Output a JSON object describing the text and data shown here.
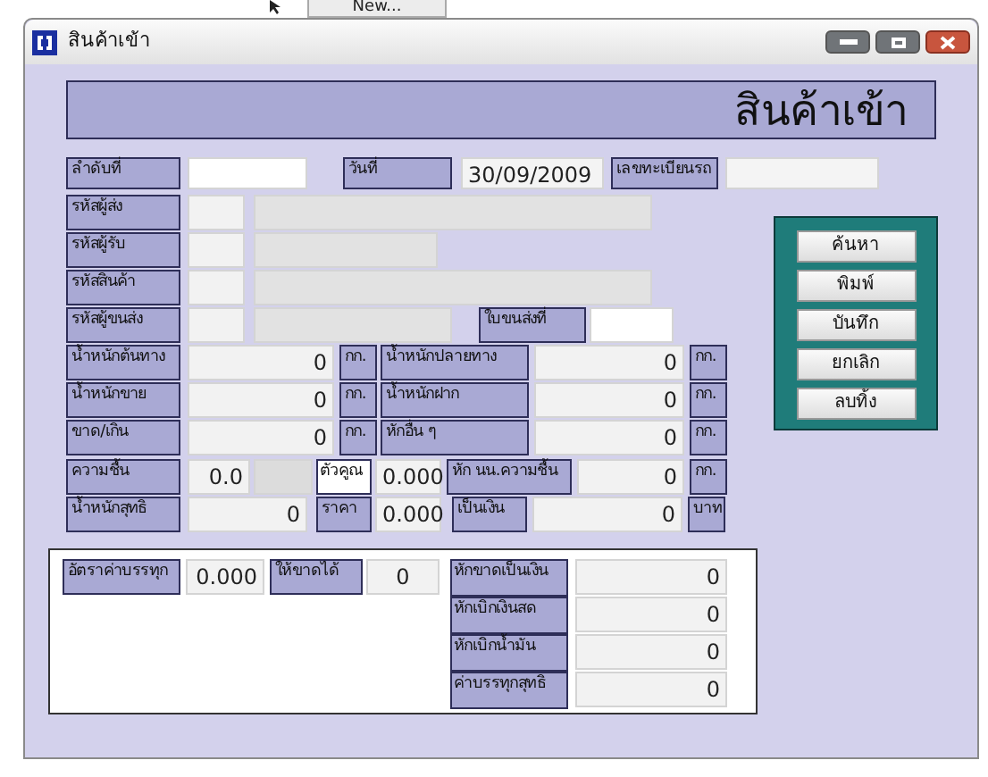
{
  "background": {
    "button": "New..."
  },
  "window": {
    "title": "สินค้าเข้า"
  },
  "header": "สินค้าเข้า",
  "rows": [
    [
      {
        "kind": "label",
        "text": "ลำดับที่"
      },
      {
        "kind": "input"
      },
      {
        "kind": "label",
        "text": "วันที่"
      },
      {
        "kind": "input",
        "value": "30/09/2009"
      },
      {
        "kind": "label",
        "text": "เลขทะเบียนรถ"
      },
      {
        "kind": "input"
      }
    ],
    [
      {
        "kind": "label",
        "text": "รหัสผู้ส่ง"
      },
      {
        "kind": "input"
      },
      {
        "kind": "input"
      }
    ],
    [
      {
        "kind": "label",
        "text": "รหัสผู้รับ"
      },
      {
        "kind": "input"
      },
      {
        "kind": "input"
      }
    ],
    [
      {
        "kind": "label",
        "text": "รหัสสินค้า"
      },
      {
        "kind": "input"
      },
      {
        "kind": "input"
      }
    ],
    [
      {
        "kind": "label",
        "text": "รหัสผู้ขนส่ง"
      },
      {
        "kind": "input"
      },
      {
        "kind": "input"
      },
      {
        "kind": "label",
        "text": "ใบขนส่งที่"
      },
      {
        "kind": "input"
      }
    ],
    [
      {
        "kind": "label",
        "text": "น้ำหนักต้นทาง"
      },
      {
        "kind": "input",
        "value": "0"
      },
      {
        "kind": "unit",
        "text": "กก."
      },
      {
        "kind": "label",
        "text": "น้ำหนักปลายทาง"
      },
      {
        "kind": "input",
        "value": "0"
      },
      {
        "kind": "unit",
        "text": "กก."
      }
    ],
    [
      {
        "kind": "label",
        "text": "น้ำหนักขาย"
      },
      {
        "kind": "input",
        "value": "0"
      },
      {
        "kind": "unit",
        "text": "กก."
      },
      {
        "kind": "label",
        "text": "น้ำหนักฝาก"
      },
      {
        "kind": "input",
        "value": "0"
      },
      {
        "kind": "unit",
        "text": "กก."
      }
    ],
    [
      {
        "kind": "label",
        "text": "ขาด/เกิน"
      },
      {
        "kind": "input",
        "value": "0"
      },
      {
        "kind": "unit",
        "text": "กก."
      },
      {
        "kind": "label",
        "text": "หักอื่น ๆ"
      },
      {
        "kind": "input",
        "value": "0"
      },
      {
        "kind": "unit",
        "text": "กก."
      }
    ],
    [
      {
        "kind": "label",
        "text": "ความชื้น"
      },
      {
        "kind": "input",
        "value": "0.0"
      },
      {
        "kind": "input"
      },
      {
        "kind": "tag",
        "text": "ตัวคูณ"
      },
      {
        "kind": "input",
        "value": "0.000"
      },
      {
        "kind": "label",
        "text": "หัก นน.ความชื้น"
      },
      {
        "kind": "input",
        "value": "0"
      },
      {
        "kind": "unit",
        "text": "กก."
      }
    ],
    [
      {
        "kind": "label",
        "text": "น้ำหนักสุทธิ"
      },
      {
        "kind": "input",
        "value": "0"
      },
      {
        "kind": "label",
        "text": "ราคา"
      },
      {
        "kind": "input",
        "value": "0.000"
      },
      {
        "kind": "label",
        "text": "เป็นเงิน"
      },
      {
        "kind": "input",
        "value": "0"
      },
      {
        "kind": "unit",
        "text": "บาท"
      }
    ]
  ],
  "actions": [
    "ค้นหา",
    "พิมพ์",
    "บันทึก",
    "ยกเลิก",
    "ลบทิ้ง"
  ],
  "freight": [
    {
      "kind": "label",
      "text": "อัตราค่าบรรทุก"
    },
    {
      "kind": "input",
      "value": "0.000"
    },
    {
      "kind": "label",
      "text": "ให้ขาดได้"
    },
    {
      "kind": "input",
      "value": "0"
    }
  ],
  "summary": [
    {
      "label": "หักขาดเป็นเงิน",
      "value": "0"
    },
    {
      "label": "หักเบิกเงินสด",
      "value": "0"
    },
    {
      "label": "หักเบิกน้ำมัน",
      "value": "0"
    },
    {
      "label": "ค่าบรรทุกสุทธิ",
      "value": "0"
    }
  ]
}
